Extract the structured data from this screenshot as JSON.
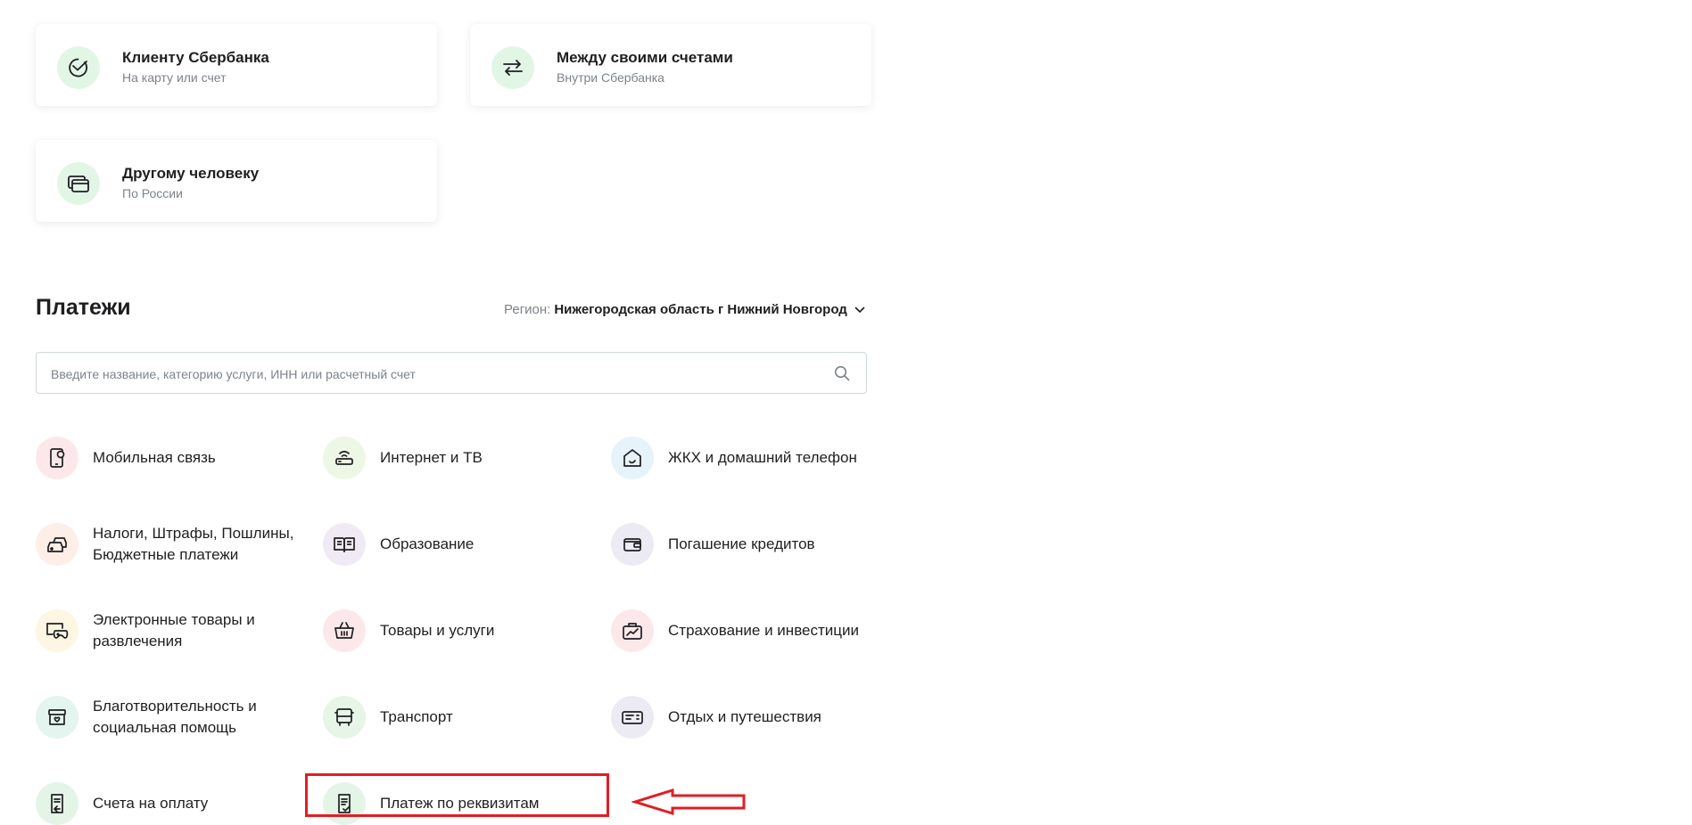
{
  "transfers": [
    {
      "title": "Клиенту Сбербанка",
      "subtitle": "На карту или счет",
      "icon": "sber-logo-icon"
    },
    {
      "title": "Между своими счетами",
      "subtitle": "Внутри Сбербанка",
      "icon": "arrows-exchange-icon"
    },
    {
      "title": "Другому человеку",
      "subtitle": "По России",
      "icon": "cards-icon"
    }
  ],
  "payments": {
    "title": "Платежи",
    "region_label": "Регион:",
    "region_value": "Нижегородская область г Нижний Новгород",
    "search_placeholder": "Введите название, категорию услуги, ИНН или расчетный счет",
    "categories": [
      {
        "label": "Мобильная связь",
        "icon": "mobile-phone-icon",
        "bg": "#fce8ea"
      },
      {
        "label": "Интернет и ТВ",
        "icon": "router-icon",
        "bg": "#eef7e6"
      },
      {
        "label": "ЖКХ и домашний телефон",
        "icon": "house-icon",
        "bg": "#e6f3fb"
      },
      {
        "label": "Налоги, Штрафы, Пошлины, Бюджетные платежи",
        "icon": "car-icon",
        "bg": "#fdeee8"
      },
      {
        "label": "Образование",
        "icon": "book-icon",
        "bg": "#f0eaf5"
      },
      {
        "label": "Погашение кредитов",
        "icon": "wallet-icon",
        "bg": "#eceaf3"
      },
      {
        "label": "Электронные товары и развлечения",
        "icon": "gamepad-icon",
        "bg": "#fdf6e3"
      },
      {
        "label": "Товары и услуги",
        "icon": "basket-icon",
        "bg": "#fce8ea"
      },
      {
        "label": "Страхование и инвестиции",
        "icon": "briefcase-chart-icon",
        "bg": "#fce8ea"
      },
      {
        "label": "Благотворительность и социальная помощь",
        "icon": "donation-box-icon",
        "bg": "#e3f5ee"
      },
      {
        "label": "Транспорт",
        "icon": "bus-icon",
        "bg": "#e6f5e6"
      },
      {
        "label": "Отдых и путешествия",
        "icon": "ticket-icon",
        "bg": "#eceaf3"
      },
      {
        "label": "Счета на оплату",
        "icon": "invoice-icon",
        "bg": "#e4f5e8"
      },
      {
        "label": "Платеж по реквизитам",
        "icon": "document-check-icon",
        "bg": "#e4f5e8"
      }
    ]
  },
  "colors": {
    "accent": "#21a038",
    "highlight": "#e01e24",
    "muted": "#7d838a"
  }
}
